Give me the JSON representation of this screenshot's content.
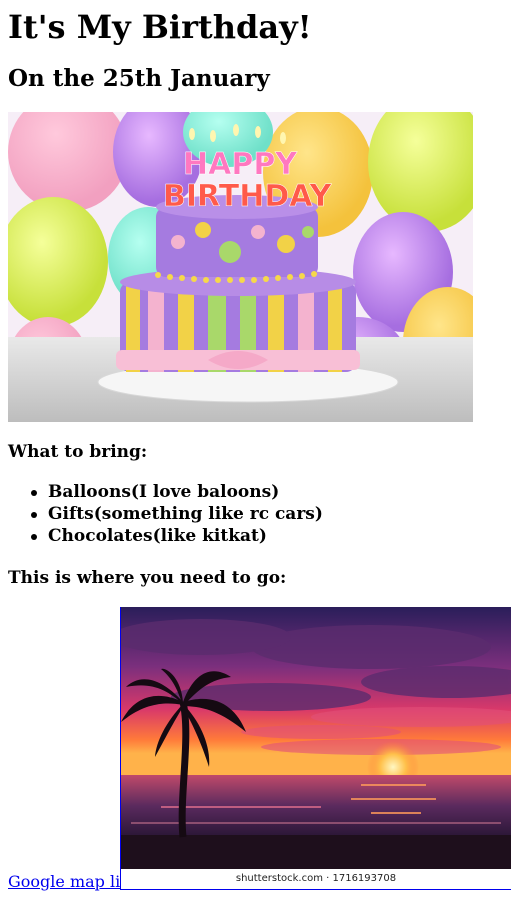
{
  "page": {
    "title": "It's My Birthday!",
    "date_heading": "On the 25th January",
    "bring_heading": "What to bring:",
    "bring_items": [
      "Balloons(I love baloons)",
      "Gifts(something like rc cars)",
      "Chocolates(like kitkat)"
    ],
    "go_heading": "This is where you need to go:",
    "map_link_label": "Google map link",
    "image_caption": "shutterstock.com · 1716193708"
  },
  "images": {
    "cake": {
      "icon": "birthday-cake-image",
      "candle_letters_top": "HAPPY",
      "candle_letters_bottom": "BIRTHDAY"
    },
    "beach": {
      "icon": "sunset-beach-image"
    }
  },
  "colors": {
    "link": "#0000ee"
  }
}
